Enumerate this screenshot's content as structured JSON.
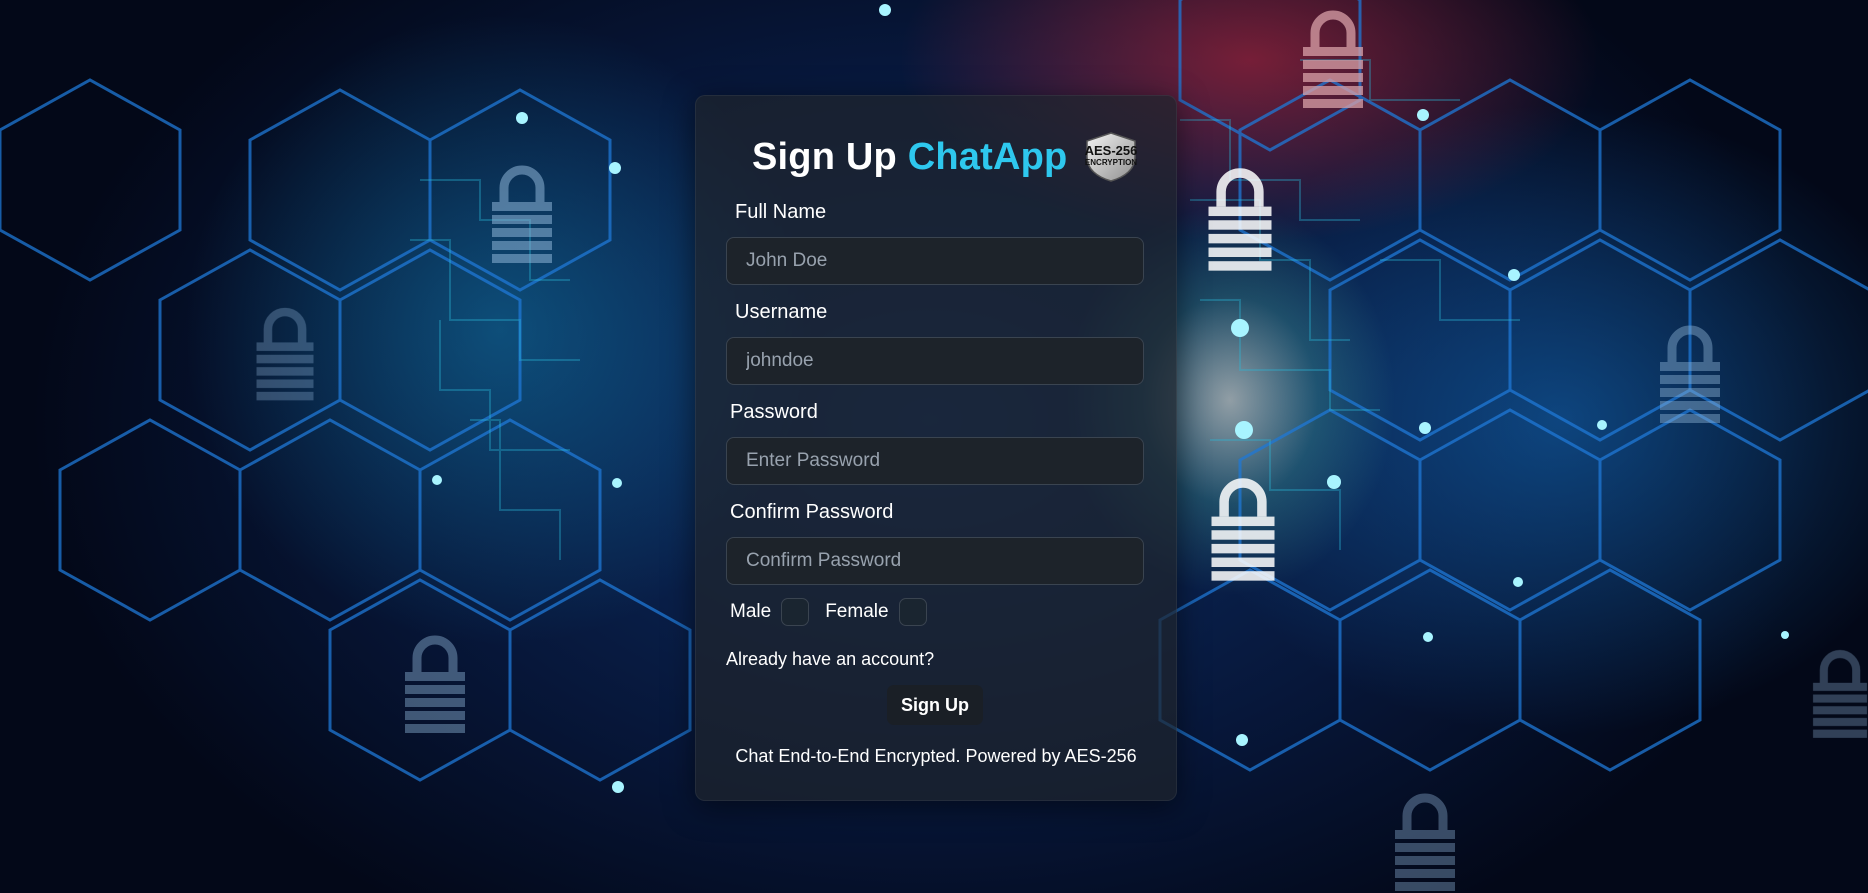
{
  "header": {
    "title_prefix": "Sign Up",
    "title_accent": "ChatApp",
    "badge_line1": "AES-256",
    "badge_line2": "ENCRYPTION"
  },
  "form": {
    "full_name": {
      "label": "Full Name",
      "placeholder": "John Doe"
    },
    "username": {
      "label": "Username",
      "placeholder": "johndoe"
    },
    "password": {
      "label": "Password",
      "placeholder": "Enter Password"
    },
    "confirm_password": {
      "label": "Confirm Password",
      "placeholder": "Confirm Password"
    },
    "gender": {
      "male_label": "Male",
      "female_label": "Female"
    },
    "login_link": "Already have an account?",
    "submit_label": "Sign Up"
  },
  "footer": {
    "text": "Chat End-to-End Encrypted. Powered by AES-256"
  },
  "colors": {
    "accent": "#2ec8ee",
    "card_bg": "#1e242c",
    "input_bg": "#1d232a",
    "background": "#07173a"
  },
  "icons": [
    "lock-icon",
    "shield-badge-icon",
    "circuit-pattern"
  ]
}
